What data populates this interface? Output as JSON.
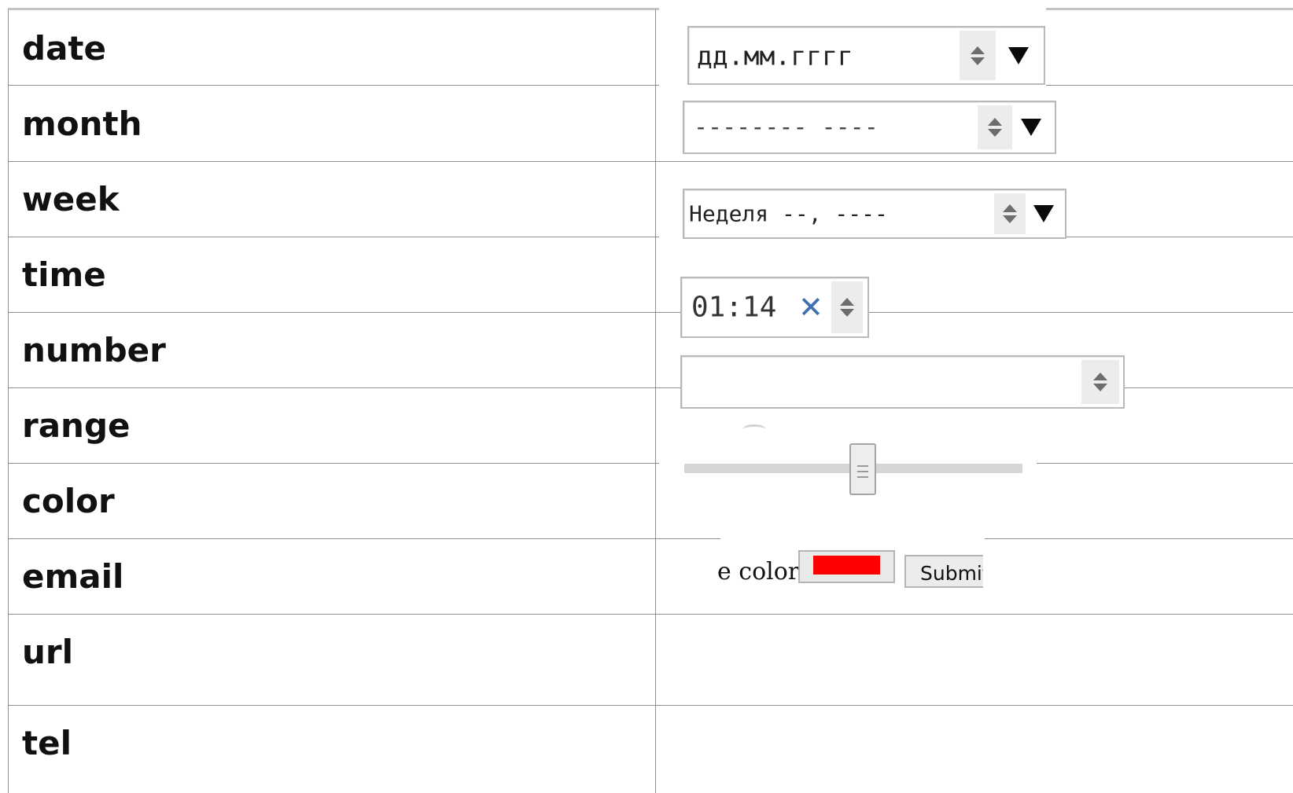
{
  "rows": [
    {
      "label": "date"
    },
    {
      "label": "month"
    },
    {
      "label": "week"
    },
    {
      "label": "time"
    },
    {
      "label": "number"
    },
    {
      "label": "range"
    },
    {
      "label": "color"
    },
    {
      "label": "email"
    },
    {
      "label": "url"
    },
    {
      "label": "tel"
    }
  ],
  "controls": {
    "date": {
      "placeholder": "дд.мм.гггг"
    },
    "month": {
      "placeholder": "-------- ----"
    },
    "week": {
      "placeholder": "Неделя --, ----"
    },
    "time": {
      "value": "01:14",
      "clear_glyph": "✕"
    },
    "number": {
      "value": ""
    },
    "range": {
      "value_fraction": 0.53
    },
    "color": {
      "caption": "e color:",
      "selected_color": "#ff0000",
      "submit_label": "Submit"
    }
  },
  "icons": {
    "spinner": "spinner-up-down-icon",
    "dropdown": "dropdown-triangle-icon",
    "clear": "clear-x-icon"
  },
  "colors": {
    "grid": "#8f8f8f",
    "top_border": "#c4c4c4",
    "clear_x": "#3f6fb0",
    "swatch": "#ff0000"
  }
}
